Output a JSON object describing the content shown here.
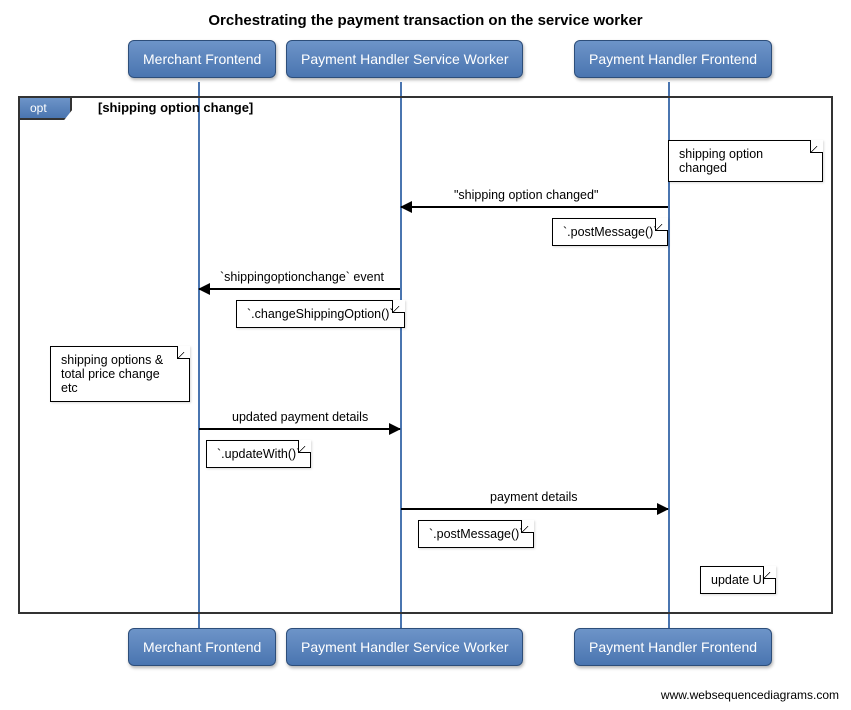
{
  "title": "Orchestrating the payment transaction on the service worker",
  "participants": {
    "p1": "Merchant Frontend",
    "p2": "Payment Handler Service Worker",
    "p3": "Payment Handler Frontend"
  },
  "fragment": {
    "type_label": "opt",
    "condition": "[shipping option change]"
  },
  "notes": {
    "n1": "shipping option changed",
    "n2": "`.postMessage()`",
    "n3": "`.changeShippingOption()`",
    "n4_line1": "shipping options &",
    "n4_line2": "total price change etc",
    "n5": "`.updateWith()`",
    "n6": "`.postMessage()`",
    "n7": "update UI"
  },
  "messages": {
    "m1": "\"shipping option changed\"",
    "m2": "`shippingoptionchange` event",
    "m3": "updated payment details",
    "m4": "payment details"
  },
  "attribution": "www.websequencediagrams.com",
  "chart_data": {
    "type": "sequence-diagram",
    "title": "Orchestrating the payment transaction on the service worker",
    "participants": [
      "Merchant Frontend",
      "Payment Handler Service Worker",
      "Payment Handler Frontend"
    ],
    "fragments": [
      {
        "type": "opt",
        "condition": "shipping option change",
        "steps": [
          {
            "kind": "note",
            "over": "Payment Handler Frontend",
            "text": "shipping option changed"
          },
          {
            "kind": "message",
            "from": "Payment Handler Frontend",
            "to": "Payment Handler Service Worker",
            "label": "\"shipping option changed\"",
            "mechanism": ".postMessage()"
          },
          {
            "kind": "message",
            "from": "Payment Handler Service Worker",
            "to": "Merchant Frontend",
            "label": "`shippingoptionchange` event",
            "mechanism": ".changeShippingOption()"
          },
          {
            "kind": "note",
            "over": "Merchant Frontend",
            "text": "shipping options & total price change etc"
          },
          {
            "kind": "message",
            "from": "Merchant Frontend",
            "to": "Payment Handler Service Worker",
            "label": "updated payment details",
            "mechanism": ".updateWith()"
          },
          {
            "kind": "message",
            "from": "Payment Handler Service Worker",
            "to": "Payment Handler Frontend",
            "label": "payment details",
            "mechanism": ".postMessage()"
          },
          {
            "kind": "note",
            "over": "Payment Handler Frontend",
            "text": "update UI"
          }
        ]
      }
    ]
  }
}
